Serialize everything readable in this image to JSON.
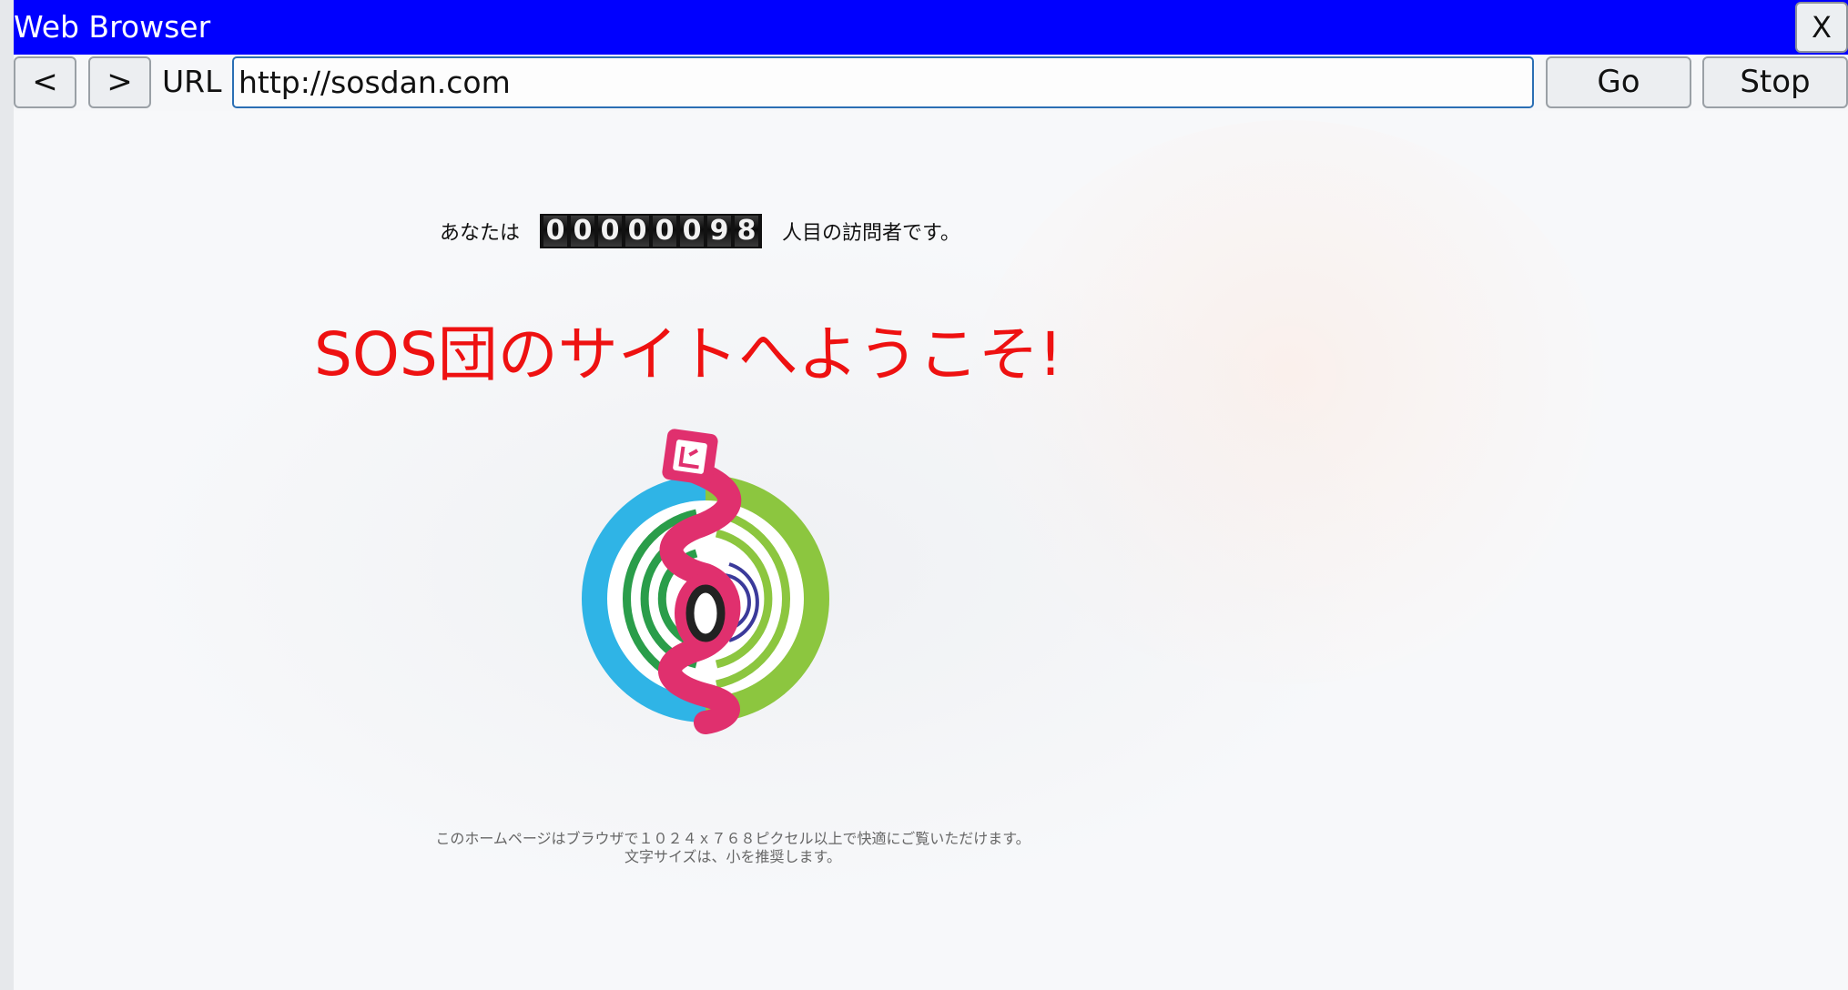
{
  "window": {
    "title": "Web Browser",
    "close_label": "X"
  },
  "toolbar": {
    "back_label": "<",
    "forward_label": ">",
    "url_label": "URL",
    "url_value": "http://sosdan.com",
    "go_label": "Go",
    "stop_label": "Stop"
  },
  "page": {
    "counter_prefix": "あなたは",
    "counter_digits": [
      "0",
      "0",
      "0",
      "0",
      "0",
      "0",
      "9",
      "8"
    ],
    "counter_suffix": "人目の訪問者です。",
    "welcome_heading": "SOS団のサイトへようこそ!",
    "emblem_letter": "O",
    "footer_line1": "このホームページはブラウザで１０２４ｘ７６８ピクセル以上で快適にご覧いただけます。",
    "footer_line2": "文字サイズは、小を推奨します。"
  },
  "colors": {
    "titlebar": "#0000ff",
    "heading": "#ee1111",
    "url_border": "#2b6fb4"
  },
  "icons": {
    "emblem": "sos-brigade-emblem"
  }
}
